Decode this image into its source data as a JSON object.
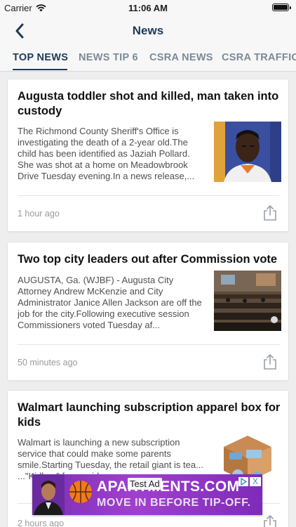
{
  "status_bar": {
    "carrier": "Carrier",
    "time": "11:06 AM"
  },
  "nav": {
    "title": "News"
  },
  "tabs": [
    {
      "label": "TOP NEWS",
      "active": true
    },
    {
      "label": "NEWS TIP 6",
      "active": false
    },
    {
      "label": "CSRA NEWS",
      "active": false
    },
    {
      "label": "CSRA TRAFFIC",
      "active": false
    }
  ],
  "articles": [
    {
      "headline": "Augusta toddler shot and killed, man taken into custody",
      "summary": "The Richmond County Sheriff's Office is investigating the death of a 2-year old.The child has been identified as Jaziah Pollard. She was shot at a home on Meadowbrook Drive Tuesday evening.In a news release,...",
      "time": "1 hour ago",
      "thumbnail_icon": "mugshot-photo"
    },
    {
      "headline": "Two top city leaders out after Commission vote",
      "summary": "AUGUSTA, Ga. (WJBF) - Augusta City Attorney Andrew McKenzie and City Administrator Janice Allen Jackson are off the job for the city.Following executive session Commissioners voted Tuesday af...",
      "time": "50 minutes ago",
      "thumbnail_icon": "commission-chamber-photo"
    },
    {
      "headline": "Walmart launching subscription apparel box for kids",
      "summary": "Walmart is launching a new subscription service that could make some parents smile.Starting Tuesday, the retail giant is tea... ...\"Kidbox\" f... ...ovides a ser...",
      "time": "2 hours ago",
      "thumbnail_icon": "apparel-box-photo"
    }
  ],
  "ad": {
    "label": "Test Ad",
    "line1": "APARTMENTS.COM",
    "line2": "MOVE IN BEFORE TIP-OFF.",
    "close": "X"
  },
  "colors": {
    "accent": "#1f3a5a",
    "inactive_tab": "#7b8a97",
    "ad_purple": "#8e36c0"
  }
}
